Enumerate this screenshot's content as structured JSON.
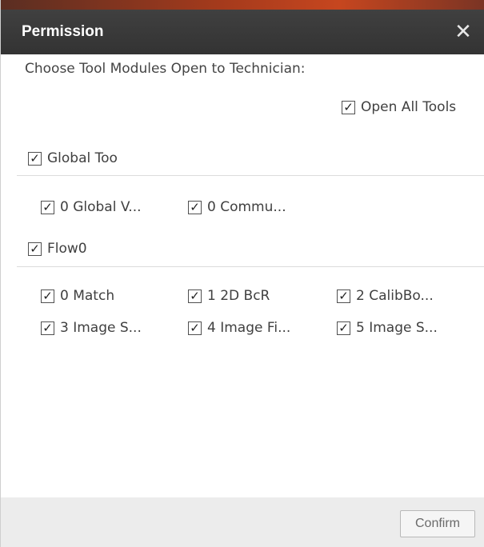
{
  "dialog": {
    "title": "Permission",
    "close_icon": "close-icon",
    "instruction": "Choose Tool Modules Open to Technician:",
    "open_all": {
      "label": "Open All Tools",
      "checked": true
    },
    "groups": [
      {
        "label": "Global Too",
        "checked": true,
        "items": [
          {
            "label": "0 Global V...",
            "checked": true
          },
          {
            "label": "0 Commu...",
            "checked": true
          }
        ]
      },
      {
        "label": "Flow0",
        "checked": true,
        "items": [
          {
            "label": "0 Match",
            "checked": true
          },
          {
            "label": "1 2D BcR",
            "checked": true
          },
          {
            "label": "2 CalibBo...",
            "checked": true
          },
          {
            "label": "3 Image S...",
            "checked": true
          },
          {
            "label": "4 Image Fi...",
            "checked": true
          },
          {
            "label": "5 Image S...",
            "checked": true
          }
        ]
      }
    ],
    "confirm_label": "Confirm",
    "check_glyph": "✓"
  },
  "colors": {
    "titlebar": "#383838",
    "accent": "#c6461f",
    "footer": "#ececec"
  }
}
